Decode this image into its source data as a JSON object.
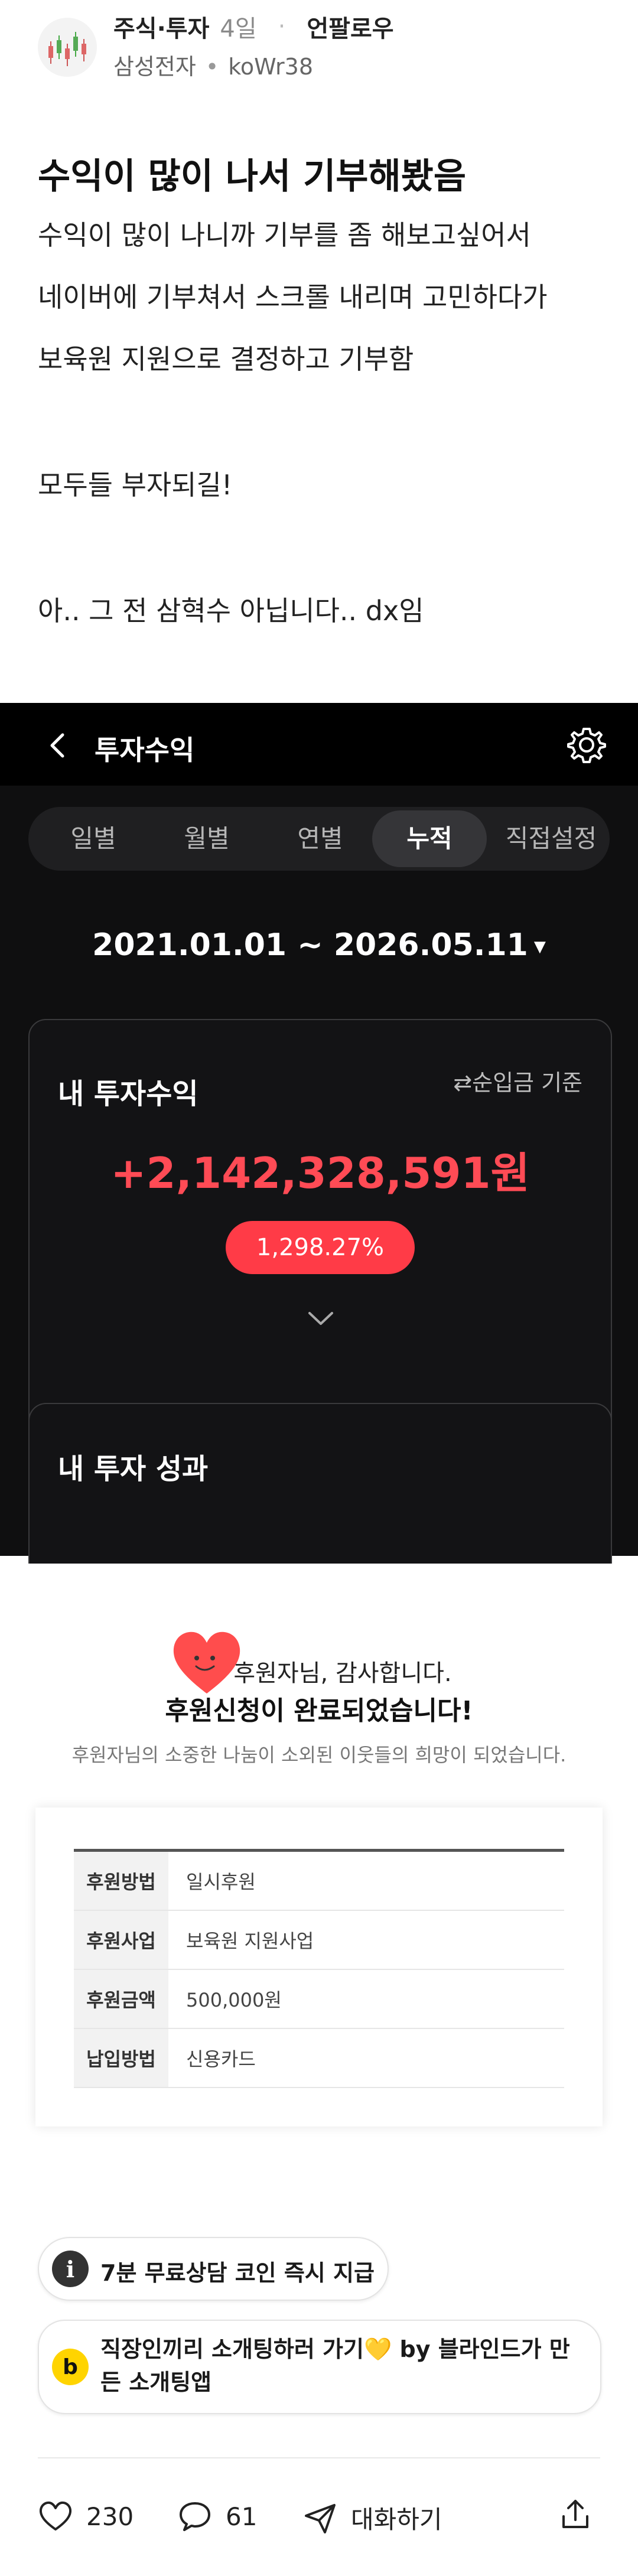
{
  "post": {
    "category": "주식·투자",
    "time": "4일",
    "author": "언팔로우",
    "company": "삼성전자",
    "user_id": "koWr38",
    "title": "수익이 많이 나서 기부해봤음",
    "body": [
      "수익이 많이 나니까 기부를 좀 해보고싶어서",
      "네이버에 기부쳐서 스크롤 내리며 고민하다가",
      "보육원 지원으로 결정하고 기부함",
      "모두들 부자되길!",
      "아.. 그 전 삼혁수 아닙니다.. dx임"
    ]
  },
  "app_screenshot": {
    "back_icon": "chevron-left-icon",
    "title": "투자수익",
    "tabs": [
      "일별",
      "월별",
      "연별",
      "누적",
      "직접설정"
    ],
    "active_tab": "누적",
    "date_range": "2021.01.01 ~ 2026.05.11",
    "card_title": "내 투자수익",
    "basis_label": "⇄순입금 기준",
    "profit_amount": "+2,142,328,591원",
    "profit_percent": "1,298.27%",
    "card2_title": "내 투자 성과",
    "accent": "#ff4b55"
  },
  "donation": {
    "thanks_line": "후원자님, 감사합니다.",
    "complete_line": "후원신청이 완료되었습니다!",
    "sub_line": "후원자님의 소중한 나눔이 소외된 이웃들의 희망이 되었습니다.",
    "rows": [
      {
        "key": "후원방법",
        "value": "일시후원"
      },
      {
        "key": "후원사업",
        "value": "보육원 지원사업"
      },
      {
        "key": "후원금액",
        "value": "500,000원"
      },
      {
        "key": "납입방법",
        "value": "신용카드"
      }
    ]
  },
  "promos": {
    "consult": "7분 무료상담 코인 즉시 지급",
    "blind": "직장인끼리 소개팅하러 가기💛 by 블라인드가 만든 소개팅앱"
  },
  "actions": {
    "likes": "230",
    "comments": "61",
    "dm_label": "대화하기"
  }
}
